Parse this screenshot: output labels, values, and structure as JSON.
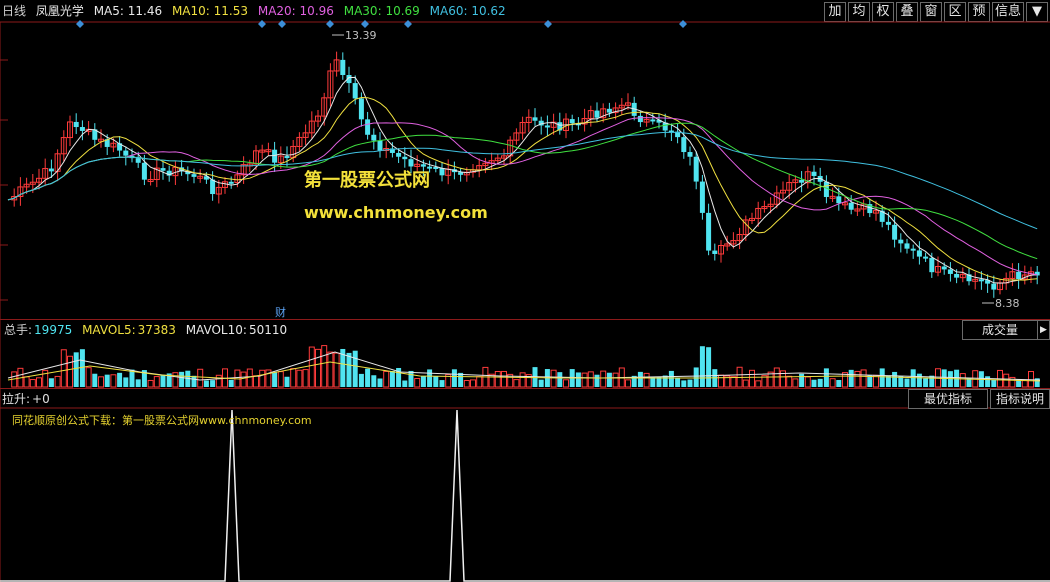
{
  "header": {
    "period": "日线",
    "stock_name": "凤凰光学",
    "ma": [
      {
        "label": "MA5:",
        "value": "11.46",
        "color": "#e8e8e8"
      },
      {
        "label": "MA10:",
        "value": "11.53",
        "color": "#f0e040"
      },
      {
        "label": "MA20:",
        "value": "10.96",
        "color": "#e060e0"
      },
      {
        "label": "MA30:",
        "value": "10.69",
        "color": "#40e040"
      },
      {
        "label": "MA60:",
        "value": "10.62",
        "color": "#40c0e0"
      }
    ]
  },
  "toolbar": [
    "加",
    "均",
    "权",
    "叠",
    "窗",
    "区",
    "预",
    "信息",
    "▼"
  ],
  "price_panel": {
    "high_label": "13.39",
    "low_label": "8.38",
    "finance_marker": "财",
    "watermark_cn": "第一股票公式网",
    "watermark_url": "www.chnmoney.com"
  },
  "volume_panel": {
    "total_label": "总手:",
    "total_value": "19975",
    "mavol5_label": "MAVOL5:",
    "mavol5_value": "37383",
    "mavol10_label": "MAVOL10:",
    "mavol10_value": "50110",
    "selector": "成交量",
    "selector_arrow": "▶"
  },
  "indicator_panel": {
    "label": "拉升:",
    "value": "+0",
    "optimal_button": "最优指标",
    "explain_button": "指标说明",
    "note": "同花顺原创公式下载：第一股票公式网www.chnmoney.com"
  },
  "colors": {
    "up": "#ff3b3b",
    "down": "#50e4f0",
    "ma5": "#e8e8e8",
    "ma10": "#f0e040",
    "ma20": "#e060e0",
    "ma30": "#40e040",
    "ma60": "#40c0e0",
    "border": "#8c1a1a",
    "diamond": "#3c8fd8"
  }
}
